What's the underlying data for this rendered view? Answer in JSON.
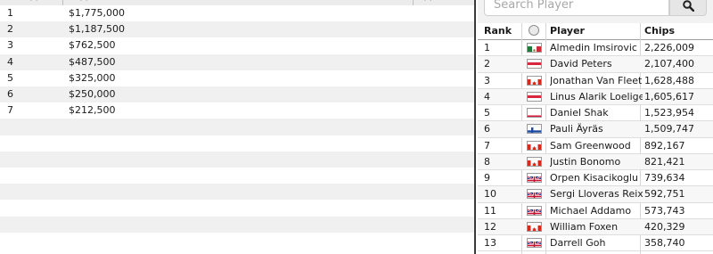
{
  "payouts": {
    "header": {
      "place_label": "(.)",
      "prize_label": "(.)",
      "extra_label": "(.)"
    },
    "rows": [
      {
        "place": "1",
        "prize": "$1,775,000"
      },
      {
        "place": "2",
        "prize": "$1,187,500"
      },
      {
        "place": "3",
        "prize": "$762,500"
      },
      {
        "place": "4",
        "prize": "$487,500"
      },
      {
        "place": "5",
        "prize": "$325,000"
      },
      {
        "place": "6",
        "prize": "$250,000"
      },
      {
        "place": "7",
        "prize": "$212,500"
      }
    ],
    "empty_row_count": 8
  },
  "search": {
    "placeholder": "Search Player",
    "icon": "search-icon"
  },
  "leaderboard": {
    "headers": {
      "rank": "Rank",
      "flag": "globe-icon",
      "player": "Player",
      "chips": "Chips"
    },
    "rows": [
      {
        "rank": "1",
        "flag": "mexico-flag-icon",
        "player": "Almedin Imsirovic",
        "chips": "2,226,009"
      },
      {
        "rank": "2",
        "flag": "austria-flag-icon",
        "player": "David Peters",
        "chips": "2,107,400"
      },
      {
        "rank": "3",
        "flag": "canada-flag-icon",
        "player": "Jonathan Van Fleet",
        "chips": "1,628,488"
      },
      {
        "rank": "4",
        "flag": "austria-flag-icon",
        "player": "Linus Alarik Loeliger",
        "chips": "1,605,617"
      },
      {
        "rank": "5",
        "flag": "poland-flag-icon",
        "player": "Daniel Shak",
        "chips": "1,523,954"
      },
      {
        "rank": "6",
        "flag": "finland-flag-icon",
        "player": "Pauli Äyräs",
        "chips": "1,509,747"
      },
      {
        "rank": "7",
        "flag": "canada-flag-icon",
        "player": "Sam Greenwood",
        "chips": "892,167"
      },
      {
        "rank": "8",
        "flag": "canada-flag-icon",
        "player": "Justin Bonomo",
        "chips": "821,421"
      },
      {
        "rank": "9",
        "flag": "uk-flag-icon",
        "player": "Orpen Kisacikoglu",
        "chips": "739,634"
      },
      {
        "rank": "10",
        "flag": "uk-flag-icon",
        "player": "Sergi Lloveras Reixach",
        "chips": "592,751"
      },
      {
        "rank": "11",
        "flag": "uk-flag-icon",
        "player": "Michael Addamo",
        "chips": "573,743"
      },
      {
        "rank": "12",
        "flag": "canada-flag-icon",
        "player": "William Foxen",
        "chips": "420,329"
      },
      {
        "rank": "13",
        "flag": "uk-flag-icon",
        "player": "Darrell Goh",
        "chips": "358,740"
      }
    ]
  }
}
